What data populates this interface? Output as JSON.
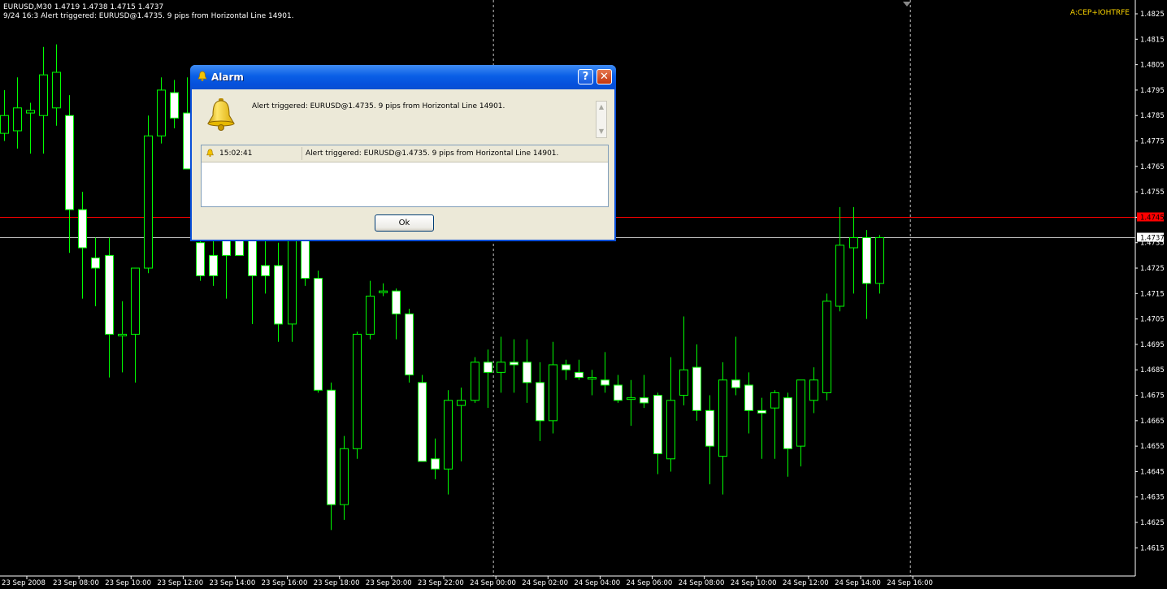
{
  "chart_header": {
    "symbol_line": "EURUSD,M30  1.4719 1.4738 1.4715 1.4737",
    "alert_line": "9/24 16:3 Alert triggered: EURUSD@1.4735.  9 pips from Horizontal Line 14901."
  },
  "expert_label": "A:CEP+IOHTRFE",
  "colors": {
    "background": "#000000",
    "candle_bull_body": "#000000",
    "candle_bear_body": "#ffffff",
    "candle_outline": "#00ff00",
    "alert_line": "#ff0000",
    "bid_line": "#c0c0c0",
    "axis_text": "#ffffff",
    "expert_label": "#ffd700"
  },
  "chart_data": {
    "type": "candlestick",
    "symbol": "EURUSD",
    "timeframe": "M30",
    "ylim": [
      1.461,
      1.4825
    ],
    "y_ticks": [
      "1.4825",
      "1.4815",
      "1.4805",
      "1.4795",
      "1.4785",
      "1.4775",
      "1.4765",
      "1.4755",
      "1.4745",
      "1.4735",
      "1.4725",
      "1.4715",
      "1.4705",
      "1.4695",
      "1.4685",
      "1.4675",
      "1.4665",
      "1.4655",
      "1.4645",
      "1.4635",
      "1.4625",
      "1.4615"
    ],
    "x_ticks": [
      "23 Sep 2008",
      "23 Sep 08:00",
      "23 Sep 10:00",
      "23 Sep 12:00",
      "23 Sep 14:00",
      "23 Sep 16:00",
      "23 Sep 18:00",
      "23 Sep 20:00",
      "23 Sep 22:00",
      "24 Sep 00:00",
      "24 Sep 02:00",
      "24 Sep 04:00",
      "24 Sep 06:00",
      "24 Sep 08:00",
      "24 Sep 10:00",
      "24 Sep 12:00",
      "24 Sep 14:00",
      "24 Sep 16:00"
    ],
    "horizontal_lines": [
      {
        "price": 1.4745,
        "label": "1.4745",
        "color": "#ff0000"
      },
      {
        "price": 1.4737,
        "label": "1.4737",
        "color": "#c0c0c0"
      }
    ],
    "vertical_separators": [
      "24 Sep 00:00",
      "24 Sep 16:00"
    ],
    "candles": [
      {
        "o": 1.4778,
        "h": 1.4795,
        "l": 1.4775,
        "c": 1.4785
      },
      {
        "o": 1.4779,
        "h": 1.48,
        "l": 1.4772,
        "c": 1.4788
      },
      {
        "o": 1.4786,
        "h": 1.479,
        "l": 1.477,
        "c": 1.4787
      },
      {
        "o": 1.4785,
        "h": 1.4812,
        "l": 1.477,
        "c": 1.4801
      },
      {
        "o": 1.4788,
        "h": 1.4813,
        "l": 1.4781,
        "c": 1.4802
      },
      {
        "o": 1.4785,
        "h": 1.4793,
        "l": 1.4731,
        "c": 1.4748
      },
      {
        "o": 1.4748,
        "h": 1.4755,
        "l": 1.4713,
        "c": 1.4733
      },
      {
        "o": 1.4729,
        "h": 1.4737,
        "l": 1.471,
        "c": 1.4725
      },
      {
        "o": 1.473,
        "h": 1.4737,
        "l": 1.4682,
        "c": 1.4699
      },
      {
        "o": 1.4699,
        "h": 1.4712,
        "l": 1.4684,
        "c": 1.4699
      },
      {
        "o": 1.4699,
        "h": 1.4715,
        "l": 1.468,
        "c": 1.4725
      },
      {
        "o": 1.4725,
        "h": 1.4785,
        "l": 1.4723,
        "c": 1.4777
      },
      {
        "o": 1.4777,
        "h": 1.48,
        "l": 1.4774,
        "c": 1.4795
      },
      {
        "o": 1.4794,
        "h": 1.4799,
        "l": 1.478,
        "c": 1.4784
      },
      {
        "o": 1.4786,
        "h": 1.48,
        "l": 1.478,
        "c": 1.4764
      },
      {
        "o": 1.4735,
        "h": 1.474,
        "l": 1.472,
        "c": 1.4722
      },
      {
        "o": 1.473,
        "h": 1.474,
        "l": 1.4718,
        "c": 1.4722
      },
      {
        "o": 1.4738,
        "h": 1.474,
        "l": 1.4713,
        "c": 1.473
      },
      {
        "o": 1.4745,
        "h": 1.476,
        "l": 1.473,
        "c": 1.473
      },
      {
        "o": 1.4738,
        "h": 1.4748,
        "l": 1.4703,
        "c": 1.4722
      },
      {
        "o": 1.4726,
        "h": 1.4742,
        "l": 1.4715,
        "c": 1.4722
      },
      {
        "o": 1.4726,
        "h": 1.4735,
        "l": 1.4696,
        "c": 1.4703
      },
      {
        "o": 1.4703,
        "h": 1.4745,
        "l": 1.4696,
        "c": 1.4736
      },
      {
        "o": 1.4736,
        "h": 1.474,
        "l": 1.4718,
        "c": 1.4721
      },
      {
        "o": 1.4721,
        "h": 1.4724,
        "l": 1.4676,
        "c": 1.4677
      },
      {
        "o": 1.4677,
        "h": 1.468,
        "l": 1.4622,
        "c": 1.4632
      },
      {
        "o": 1.4632,
        "h": 1.4659,
        "l": 1.4626,
        "c": 1.4654
      },
      {
        "o": 1.4654,
        "h": 1.47,
        "l": 1.465,
        "c": 1.4699
      },
      {
        "o": 1.4699,
        "h": 1.472,
        "l": 1.4697,
        "c": 1.4714
      },
      {
        "o": 1.4716,
        "h": 1.4719,
        "l": 1.4714,
        "c": 1.4716
      },
      {
        "o": 1.4716,
        "h": 1.4717,
        "l": 1.4697,
        "c": 1.4707
      },
      {
        "o": 1.4707,
        "h": 1.4709,
        "l": 1.468,
        "c": 1.4683
      },
      {
        "o": 1.468,
        "h": 1.4683,
        "l": 1.465,
        "c": 1.4649
      },
      {
        "o": 1.465,
        "h": 1.4658,
        "l": 1.4642,
        "c": 1.4646
      },
      {
        "o": 1.4646,
        "h": 1.4677,
        "l": 1.4636,
        "c": 1.4673
      },
      {
        "o": 1.4671,
        "h": 1.4678,
        "l": 1.4649,
        "c": 1.4673
      },
      {
        "o": 1.4673,
        "h": 1.469,
        "l": 1.4672,
        "c": 1.4688
      },
      {
        "o": 1.4688,
        "h": 1.4693,
        "l": 1.467,
        "c": 1.4684
      },
      {
        "o": 1.4684,
        "h": 1.4698,
        "l": 1.4676,
        "c": 1.4688
      },
      {
        "o": 1.4688,
        "h": 1.4697,
        "l": 1.4676,
        "c": 1.4687
      },
      {
        "o": 1.4688,
        "h": 1.4697,
        "l": 1.4672,
        "c": 1.468
      },
      {
        "o": 1.468,
        "h": 1.4688,
        "l": 1.4657,
        "c": 1.4665
      },
      {
        "o": 1.4665,
        "h": 1.4696,
        "l": 1.466,
        "c": 1.4687
      },
      {
        "o": 1.4687,
        "h": 1.4689,
        "l": 1.4681,
        "c": 1.4685
      },
      {
        "o": 1.4684,
        "h": 1.4689,
        "l": 1.4681,
        "c": 1.4682
      },
      {
        "o": 1.4682,
        "h": 1.4685,
        "l": 1.4675,
        "c": 1.4682
      },
      {
        "o": 1.4681,
        "h": 1.4692,
        "l": 1.4676,
        "c": 1.4679
      },
      {
        "o": 1.4679,
        "h": 1.4683,
        "l": 1.4672,
        "c": 1.4673
      },
      {
        "o": 1.4674,
        "h": 1.4681,
        "l": 1.4663,
        "c": 1.4674
      },
      {
        "o": 1.4674,
        "h": 1.4683,
        "l": 1.467,
        "c": 1.4672
      },
      {
        "o": 1.4675,
        "h": 1.4676,
        "l": 1.4644,
        "c": 1.4652
      },
      {
        "o": 1.465,
        "h": 1.469,
        "l": 1.4645,
        "c": 1.4673
      },
      {
        "o": 1.4675,
        "h": 1.4706,
        "l": 1.4671,
        "c": 1.4685
      },
      {
        "o": 1.4686,
        "h": 1.4695,
        "l": 1.4665,
        "c": 1.4669
      },
      {
        "o": 1.4669,
        "h": 1.4675,
        "l": 1.464,
        "c": 1.4655
      },
      {
        "o": 1.4651,
        "h": 1.4688,
        "l": 1.4636,
        "c": 1.4681
      },
      {
        "o": 1.4681,
        "h": 1.4698,
        "l": 1.4675,
        "c": 1.4678
      },
      {
        "o": 1.4679,
        "h": 1.4684,
        "l": 1.466,
        "c": 1.4669
      },
      {
        "o": 1.4669,
        "h": 1.4674,
        "l": 1.465,
        "c": 1.4668
      },
      {
        "o": 1.467,
        "h": 1.4677,
        "l": 1.465,
        "c": 1.4676
      },
      {
        "o": 1.4674,
        "h": 1.4676,
        "l": 1.4643,
        "c": 1.4654
      },
      {
        "o": 1.4655,
        "h": 1.4675,
        "l": 1.4647,
        "c": 1.4681
      },
      {
        "o": 1.4673,
        "h": 1.4686,
        "l": 1.4668,
        "c": 1.4681
      },
      {
        "o": 1.4676,
        "h": 1.4715,
        "l": 1.4673,
        "c": 1.4712
      },
      {
        "o": 1.471,
        "h": 1.4749,
        "l": 1.4708,
        "c": 1.4734
      },
      {
        "o": 1.4733,
        "h": 1.4749,
        "l": 1.4715,
        "c": 1.4737
      },
      {
        "o": 1.4737,
        "h": 1.474,
        "l": 1.4705,
        "c": 1.4719
      },
      {
        "o": 1.4719,
        "h": 1.4738,
        "l": 1.4715,
        "c": 1.4737
      }
    ]
  },
  "dialog": {
    "title": "Alarm",
    "help_symbol": "?",
    "close_symbol": "✕",
    "icon": "bell-icon",
    "message": "Alert triggered: EURUSD@1.4735.  9 pips from Horizontal Line 14901.",
    "scroll_up": "▲",
    "scroll_down": "▼",
    "list": [
      {
        "time": "15:02:41",
        "message": "Alert triggered: EURUSD@1.4735.  9 pips from Horizontal Line 14901."
      }
    ],
    "ok_label": "Ok"
  }
}
